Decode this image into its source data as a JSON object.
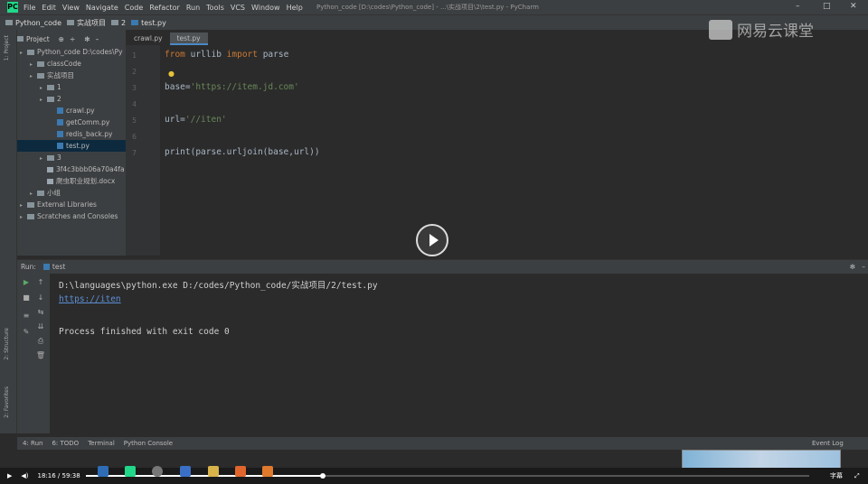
{
  "titlebar": {
    "menu": [
      "File",
      "Edit",
      "View",
      "Navigate",
      "Code",
      "Refactor",
      "Run",
      "Tools",
      "VCS",
      "Window",
      "Help"
    ],
    "window_title": "Python_code [D:\\codes\\Python_code] - ...\\实战项目\\2\\test.py - PyCharm"
  },
  "navbar": {
    "crumbs": [
      "Python_code",
      "实战项目",
      "2",
      "test.py"
    ]
  },
  "project": {
    "header": "Project",
    "tree": [
      {
        "label": "Python_code D:\\codes\\Py",
        "kind": "folder",
        "depth": 0
      },
      {
        "label": "classCode",
        "kind": "folder",
        "depth": 1
      },
      {
        "label": "实战项目",
        "kind": "folder",
        "depth": 1
      },
      {
        "label": "1",
        "kind": "folder",
        "depth": 2
      },
      {
        "label": "2",
        "kind": "folder",
        "depth": 2
      },
      {
        "label": "crawl.py",
        "kind": "py",
        "depth": 3
      },
      {
        "label": "getComm.py",
        "kind": "py",
        "depth": 3
      },
      {
        "label": "redis_back.py",
        "kind": "py",
        "depth": 3
      },
      {
        "label": "test.py",
        "kind": "py",
        "depth": 3,
        "selected": true
      },
      {
        "label": "3",
        "kind": "folder",
        "depth": 2
      },
      {
        "label": "3f4c3bbb06a70a4fa",
        "kind": "file",
        "depth": 2
      },
      {
        "label": "爬虫职业规划.docx",
        "kind": "file",
        "depth": 2
      },
      {
        "label": "小组",
        "kind": "folder",
        "depth": 1
      },
      {
        "label": "External Libraries",
        "kind": "folder",
        "depth": 0
      },
      {
        "label": "Scratches and Consoles",
        "kind": "folder",
        "depth": 0
      }
    ]
  },
  "editor": {
    "tabs": [
      "crawl.py",
      "test.py"
    ],
    "line_numbers": [
      "1",
      "2",
      "3",
      "4",
      "5",
      "6",
      "7"
    ],
    "code": [
      [
        {
          "t": "from ",
          "c": "kw"
        },
        {
          "t": "urllib ",
          "c": ""
        },
        {
          "t": "import ",
          "c": "kw"
        },
        {
          "t": "parse",
          "c": ""
        }
      ],
      [],
      [
        {
          "t": "base=",
          "c": ""
        },
        {
          "t": "'https://item.jd.com'",
          "c": "str"
        }
      ],
      [],
      [
        {
          "t": "url=",
          "c": ""
        },
        {
          "t": "'//iten'",
          "c": "str"
        }
      ],
      [],
      [
        {
          "t": "print(parse.urljoin(base,url))",
          "c": ""
        }
      ]
    ]
  },
  "run": {
    "label": "Run:",
    "config": "test",
    "output": [
      "D:\\languages\\python.exe D:/codes/Python_code/实战项目/2/test.py",
      "https://iten",
      "",
      "Process finished with exit code 0"
    ]
  },
  "bottom_tabs": [
    "4: Run",
    "6: TODO",
    "Terminal",
    "Python Console"
  ],
  "event_log": "Event Log",
  "side_labels": {
    "project": "1: Project",
    "structure": "2: Structure",
    "favorites": "2: Favorites"
  },
  "watermark": "网易云课堂",
  "player": {
    "time": "18:16 / 59:38",
    "progress": 0.327,
    "subtitle_label": "字幕"
  }
}
